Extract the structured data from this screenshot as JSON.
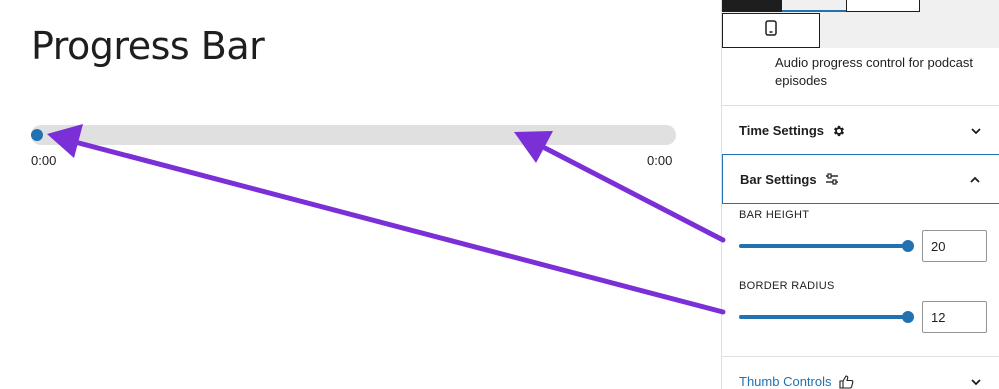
{
  "editor": {
    "page_title": "Progress Bar",
    "progress": {
      "value_fraction": 0,
      "current_time": "0:00",
      "total_time": "0:00"
    }
  },
  "sidebar": {
    "device_icon": "mobile-device-icon",
    "block_description": "Audio progress control for podcast episodes",
    "panels": [
      {
        "title": "Time Settings",
        "icon": "gear-icon",
        "expanded": false
      },
      {
        "title": "Bar Settings",
        "icon": "sliders-icon",
        "expanded": true,
        "fields": [
          {
            "label": "BAR HEIGHT",
            "value": "20",
            "slider_fraction": 1
          },
          {
            "label": "BORDER RADIUS",
            "value": "12",
            "slider_fraction": 1
          }
        ]
      },
      {
        "title": "Thumb Controls",
        "icon": "thumbs-up-icon",
        "expanded": false
      }
    ]
  },
  "colors": {
    "accent": "#2271b1",
    "annotation_arrow": "#7b2fd6",
    "track": "#e0e0e0"
  }
}
